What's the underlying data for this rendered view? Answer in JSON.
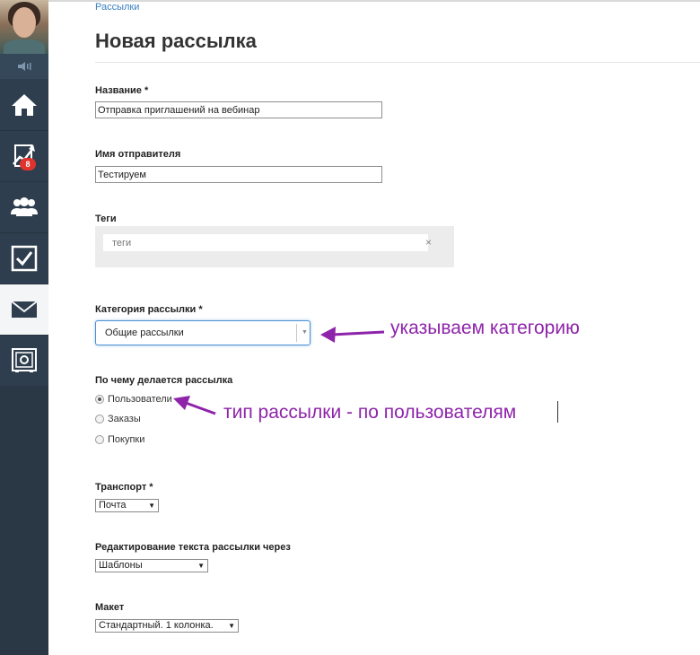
{
  "sidebar": {
    "avatar_icon": "user-avatar",
    "speaker_icon": "speaker-icon",
    "items": [
      {
        "icon": "home-icon"
      },
      {
        "icon": "chart-icon",
        "badge": "8"
      },
      {
        "icon": "users-icon"
      },
      {
        "icon": "checkbox-icon"
      },
      {
        "icon": "mail-icon",
        "active": true
      },
      {
        "icon": "safe-icon"
      }
    ]
  },
  "header": {
    "breadcrumb": "Рассылки",
    "title": "Новая рассылка"
  },
  "form": {
    "name_label": "Название *",
    "name_value": "Отправка приглашений на вебинар",
    "sender_label": "Имя отправителя",
    "sender_value": "Тестируем",
    "tags_label": "Теги",
    "tags_placeholder": "теги",
    "tags_clear": "×",
    "category_label": "Категория рассылки *",
    "category_value": "Общие рассылки",
    "type_label": "По чему делается рассылка",
    "type_options": [
      {
        "label": "Пользователи",
        "checked": true
      },
      {
        "label": "Заказы",
        "checked": false
      },
      {
        "label": "Покупки",
        "checked": false
      }
    ],
    "transport_label": "Транспорт *",
    "transport_value": "Почта",
    "editing_label": "Редактирование текста рассылки через",
    "editing_value": "Шаблоны",
    "layout_label": "Макет",
    "layout_value": "Стандартный. 1 колонка."
  },
  "annotations": {
    "category_note": "указываем категорию",
    "type_note": "тип рассылки - по пользователям",
    "color": "#8e24aa"
  },
  "colors": {
    "sidebar": "#2f3e4e",
    "badge": "#e0332e",
    "link": "#3a7fc1"
  }
}
